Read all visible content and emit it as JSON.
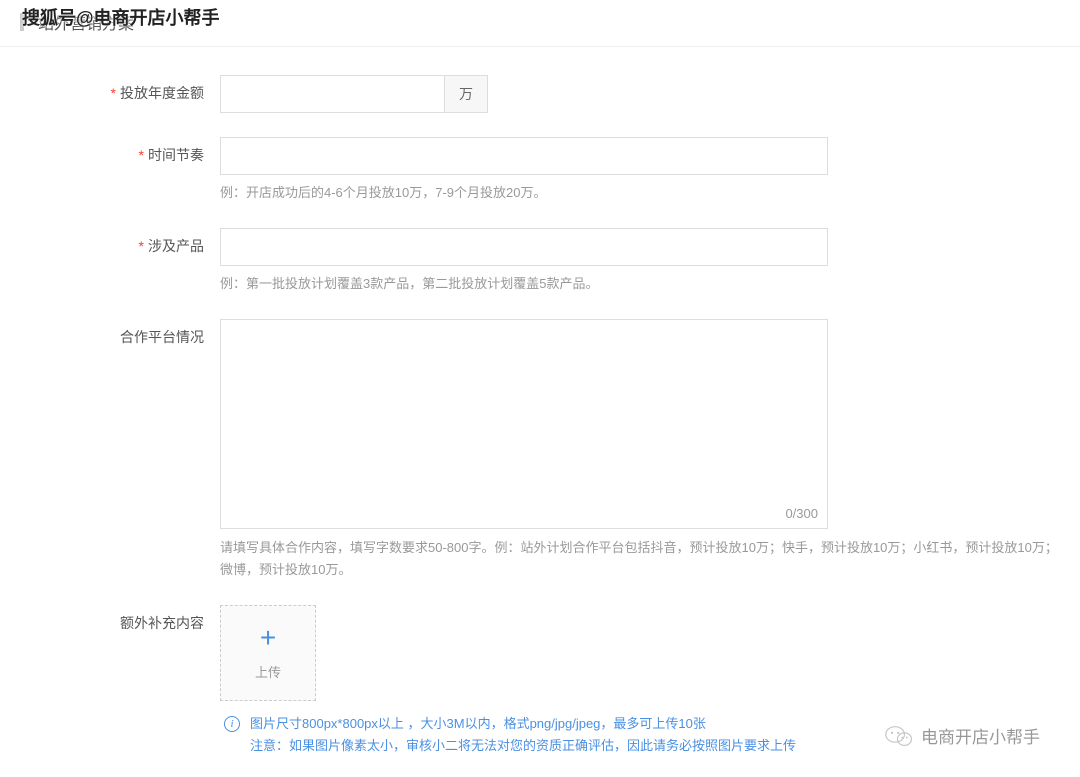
{
  "watermarks": {
    "top": "搜狐号@电商开店小帮手",
    "bottom": "电商开店小帮手"
  },
  "section": {
    "title": "站外营销方案"
  },
  "form": {
    "annual_amount": {
      "label": "投放年度金额",
      "value": "",
      "suffix": "万"
    },
    "time_rhythm": {
      "label": "时间节奏",
      "value": "",
      "hint": "例：开店成功后的4-6个月投放10万，7-9个月投放20万。"
    },
    "products": {
      "label": "涉及产品",
      "value": "",
      "hint": "例：第一批投放计划覆盖3款产品，第二批投放计划覆盖5款产品。"
    },
    "platform": {
      "label": "合作平台情况",
      "value": "",
      "counter": "0/300",
      "hint": "请填写具体合作内容，填写字数要求50-800字。例：站外计划合作平台包括抖音，预计投放10万；快手，预计投放10万；小红书，预计投放10万；微博，预计投放10万。"
    },
    "extra": {
      "label": "额外补充内容",
      "upload_text": "上传",
      "info_line1": "图片尺寸800px*800px以上 ，大小3M以内，格式png/jpg/jpeg，最多可上传10张",
      "info_line2": "注意：如果图片像素太小，审核小二将无法对您的资质正确评估，因此请务必按照图片要求上传"
    }
  }
}
